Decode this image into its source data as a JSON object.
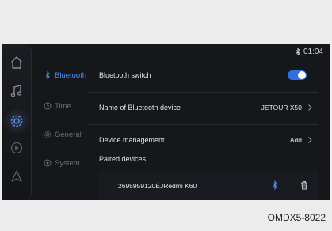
{
  "status_bar": {
    "time": "01:04",
    "bluetooth_icon": "bluetooth-icon"
  },
  "rail": {
    "icons": [
      "home-icon",
      "music-icon",
      "settings-gear-icon",
      "media-icon",
      "navigation-icon"
    ],
    "active_index": 2
  },
  "menu": {
    "items": [
      {
        "label": "Bluetooth",
        "icon": "bluetooth-icon",
        "active": true
      },
      {
        "label": "Time",
        "icon": "clock-icon",
        "active": false
      },
      {
        "label": "General",
        "icon": "gear-icon",
        "active": false
      },
      {
        "label": "System",
        "icon": "system-icon",
        "active": false
      }
    ]
  },
  "settings": {
    "bluetooth_switch": {
      "label": "Bluetooth switch",
      "on": true
    },
    "device_name": {
      "label": "Name of Bluetooth device",
      "value": "JETOUR X50"
    },
    "device_management": {
      "label": "Device management",
      "value": "Add"
    },
    "paired_devices": {
      "label": "Paired devices",
      "devices": [
        {
          "name": "2695959120ÉJRedmi K60"
        }
      ]
    }
  },
  "colors": {
    "accent": "#4f8cf7",
    "toggle_on": "#2f6fe0",
    "screen_bg": "#16171b"
  },
  "figure_code": "OMDX5-8022"
}
